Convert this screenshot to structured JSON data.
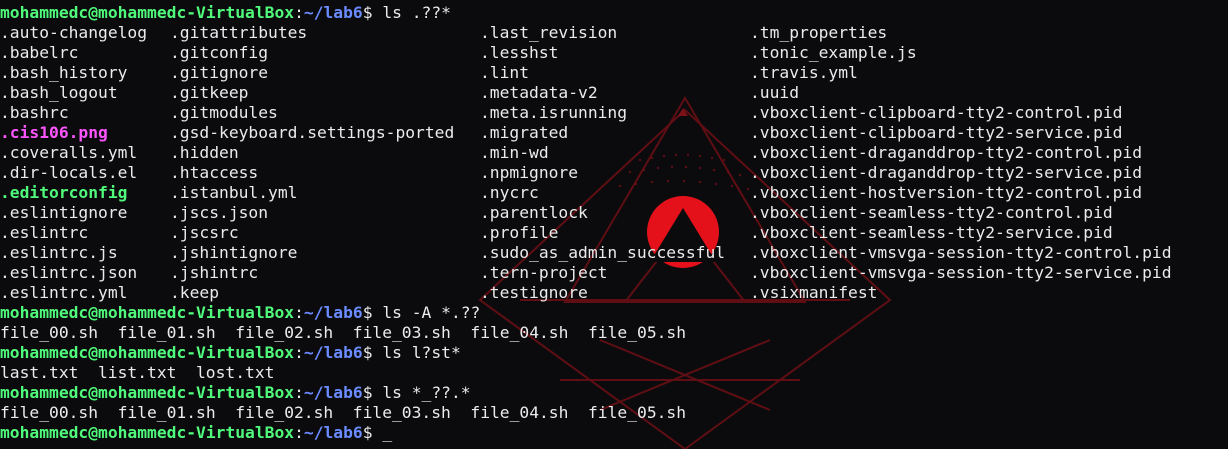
{
  "prompt": {
    "user_host": "mohammedc@mohammedc-VirtualBox",
    "sep": ":",
    "path": "~/lab6",
    "symbol": "$"
  },
  "commands": [
    {
      "cmd": " ls .??*"
    },
    {
      "cmd": " ls -A *.??"
    },
    {
      "cmd": " ls l?st*"
    },
    {
      "cmd": " ls *_??.*"
    },
    {
      "cmd": " _"
    }
  ],
  "listing_columns": [
    [
      {
        "name": ".auto-changelog",
        "style": "plain"
      },
      {
        "name": ".babelrc",
        "style": "plain"
      },
      {
        "name": ".bash_history",
        "style": "plain"
      },
      {
        "name": ".bash_logout",
        "style": "plain"
      },
      {
        "name": ".bashrc",
        "style": "plain"
      },
      {
        "name": ".cis106.png",
        "style": "magenta"
      },
      {
        "name": ".coveralls.yml",
        "style": "plain"
      },
      {
        "name": ".dir-locals.el",
        "style": "plain"
      },
      {
        "name": ".editorconfig",
        "style": "green"
      },
      {
        "name": ".eslintignore",
        "style": "plain"
      },
      {
        "name": ".eslintrc",
        "style": "plain"
      },
      {
        "name": ".eslintrc.js",
        "style": "plain"
      },
      {
        "name": ".eslintrc.json",
        "style": "plain"
      },
      {
        "name": ".eslintrc.yml",
        "style": "plain"
      }
    ],
    [
      {
        "name": ".gitattributes",
        "style": "plain"
      },
      {
        "name": ".gitconfig",
        "style": "plain"
      },
      {
        "name": ".gitignore",
        "style": "plain"
      },
      {
        "name": ".gitkeep",
        "style": "plain"
      },
      {
        "name": ".gitmodules",
        "style": "plain"
      },
      {
        "name": ".gsd-keyboard.settings-ported",
        "style": "plain"
      },
      {
        "name": ".hidden",
        "style": "plain"
      },
      {
        "name": ".htaccess",
        "style": "plain"
      },
      {
        "name": ".istanbul.yml",
        "style": "plain"
      },
      {
        "name": ".jscs.json",
        "style": "plain"
      },
      {
        "name": ".jscsrc",
        "style": "plain"
      },
      {
        "name": ".jshintignore",
        "style": "plain"
      },
      {
        "name": ".jshintrc",
        "style": "plain"
      },
      {
        "name": ".keep",
        "style": "plain"
      }
    ],
    [
      {
        "name": ".last_revision",
        "style": "plain"
      },
      {
        "name": ".lesshst",
        "style": "plain"
      },
      {
        "name": ".lint",
        "style": "plain"
      },
      {
        "name": ".metadata-v2",
        "style": "plain"
      },
      {
        "name": ".meta.isrunning",
        "style": "plain"
      },
      {
        "name": ".migrated",
        "style": "plain"
      },
      {
        "name": ".min-wd",
        "style": "plain"
      },
      {
        "name": ".npmignore",
        "style": "plain"
      },
      {
        "name": ".nycrc",
        "style": "plain"
      },
      {
        "name": ".parentlock",
        "style": "plain"
      },
      {
        "name": ".profile",
        "style": "plain"
      },
      {
        "name": ".sudo_as_admin_successful",
        "style": "plain"
      },
      {
        "name": ".tern-project",
        "style": "plain"
      },
      {
        "name": ".testignore",
        "style": "plain"
      }
    ],
    [
      {
        "name": ".tm_properties",
        "style": "plain"
      },
      {
        "name": ".tonic_example.js",
        "style": "plain"
      },
      {
        "name": ".travis.yml",
        "style": "plain"
      },
      {
        "name": ".uuid",
        "style": "plain"
      },
      {
        "name": ".vboxclient-clipboard-tty2-control.pid",
        "style": "plain"
      },
      {
        "name": ".vboxclient-clipboard-tty2-service.pid",
        "style": "plain"
      },
      {
        "name": ".vboxclient-draganddrop-tty2-control.pid",
        "style": "plain"
      },
      {
        "name": ".vboxclient-draganddrop-tty2-service.pid",
        "style": "plain"
      },
      {
        "name": ".vboxclient-hostversion-tty2-control.pid",
        "style": "plain"
      },
      {
        "name": ".vboxclient-seamless-tty2-control.pid",
        "style": "plain"
      },
      {
        "name": ".vboxclient-seamless-tty2-service.pid",
        "style": "plain"
      },
      {
        "name": ".vboxclient-vmsvga-session-tty2-control.pid",
        "style": "plain"
      },
      {
        "name": ".vboxclient-vmsvga-session-tty2-service.pid",
        "style": "plain"
      },
      {
        "name": ".vsixmanifest",
        "style": "plain"
      }
    ]
  ],
  "outputs": {
    "sh_files": [
      "file_00.sh",
      "file_01.sh",
      "file_02.sh",
      "file_03.sh",
      "file_04.sh",
      "file_05.sh"
    ],
    "txt_files": [
      "last.txt",
      "list.txt",
      "lost.txt"
    ],
    "sh_files_2": [
      "file_00.sh",
      "file_01.sh",
      "file_02.sh",
      "file_03.sh",
      "file_04.sh",
      "file_05.sh"
    ]
  },
  "theme": {
    "background": "#0b0b0e",
    "foreground": "#ebebeb",
    "user_color": "#50fa7b",
    "path_color": "#6b8cff",
    "image_file_color": "#ff55ff",
    "exec_color": "#50fa7b",
    "wallpaper_accent": "#b0101a"
  }
}
